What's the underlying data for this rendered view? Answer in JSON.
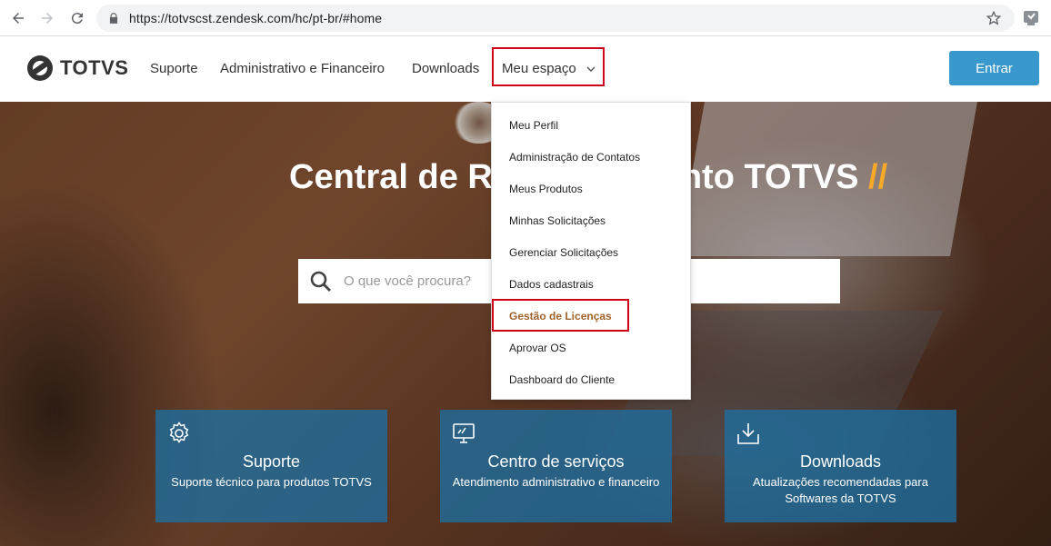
{
  "browser": {
    "url": "https://totvscst.zendesk.com/hc/pt-br/#home",
    "icons": [
      "back-arrow-icon",
      "forward-arrow-icon",
      "reload-icon",
      "lock-icon",
      "star-icon",
      "extension-icon"
    ]
  },
  "header": {
    "logo_text": "TOTVS",
    "nav": [
      {
        "label": "Suporte"
      },
      {
        "label": "Administrativo e Financeiro"
      },
      {
        "label": "Downloads"
      },
      {
        "label": "Meu espaço"
      }
    ],
    "login_label": "Entrar",
    "colors": {
      "login_button": "#3a99cc",
      "highlight_border": "#d0021b"
    }
  },
  "hero": {
    "title_main": "Central de Relacionamento TOTVS",
    "title_slashes": "//",
    "search_placeholder": "O que você procura?",
    "cards": [
      {
        "icon": "gear-icon",
        "title": "Suporte",
        "desc": "Suporte técnico para produtos TOTVS"
      },
      {
        "icon": "monitor-icon",
        "title": "Centro de serviços",
        "desc": "Atendimento administrativo e financeiro"
      },
      {
        "icon": "download-icon",
        "title": "Downloads",
        "desc": "Atualizações recomendadas para Softwares da TOTVS"
      }
    ]
  },
  "dropdown": {
    "items": [
      {
        "label": "Meu Perfil"
      },
      {
        "label": "Administração de Contatos"
      },
      {
        "label": "Meus Produtos"
      },
      {
        "label": "Minhas Solicitações"
      },
      {
        "label": "Gerenciar Solicitações"
      },
      {
        "label": "Dados cadastrais"
      },
      {
        "label": "Gestão de Licenças"
      },
      {
        "label": "Aprovar OS"
      },
      {
        "label": "Dashboard do Cliente"
      }
    ],
    "active_item": "Gestão de Licenças",
    "active_color": "#a0622b"
  }
}
